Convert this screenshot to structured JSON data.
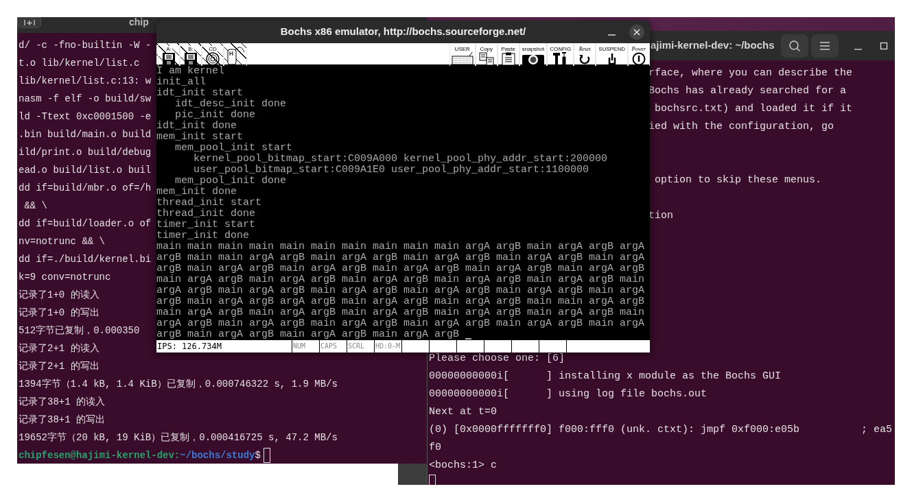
{
  "terminal_left": {
    "title": "chip",
    "lines": [
      "d/ -c -fno-builtin -W -",
      "t.o lib/kernel/list.c",
      "lib/kernel/list.c:13: w",
      "nasm -f elf -o build/sw",
      "ld -Ttext 0xc0001500 -e",
      ".bin build/main.o build",
      "ild/print.o build/debug",
      "ead.o build/list.o buil",
      "dd if=build/mbr.o of=/h",
      " && \\",
      "dd if=build/loader.o of",
      "nv=notrunc && \\",
      "dd if=./build/kernel.bi",
      "k=9 conv=notrunc",
      "记录了1+0 的读入",
      "记录了1+0 的写出",
      "512字节已复制，0.000350",
      "记录了2+1 的读入",
      "记录了2+1 的写出",
      "1394字节（1.4 kB, 1.4 KiB）已复制，0.000746322 s, 1.9 MB/s",
      "记录了38+1 的读入",
      "记录了38+1 的写出",
      "19652字节（20 kB, 19 KiB）已复制，0.000416725 s, 47.2 MB/s"
    ],
    "prompt": {
      "user_host": "chipfesen@hajimi-kernel-dev:",
      "path": "~/bochs/study",
      "symbol": "$"
    }
  },
  "bochs": {
    "title": "Bochs x86 emulator, http://bochs.sourceforge.net/",
    "toolbar_left": [
      {
        "label": "A:",
        "kind": "floppy"
      },
      {
        "label": "B:",
        "kind": "floppy"
      },
      {
        "label": "CD",
        "kind": "cdrom"
      },
      {
        "kind": "mouse"
      }
    ],
    "toolbar_right": [
      {
        "label": "USER",
        "kind": "keyboard"
      },
      {
        "label": "Copy",
        "kind": "copy"
      },
      {
        "label": "Paste",
        "kind": "paste"
      },
      {
        "label": "snapshot",
        "kind": "camera"
      },
      {
        "label": "CONFIG",
        "kind": "config"
      },
      {
        "label": "Reset",
        "kind": "reset"
      },
      {
        "label": "SUSPEND",
        "kind": "suspend"
      },
      {
        "label": "Power",
        "kind": "power"
      }
    ],
    "screen_lines": [
      "I am kernel",
      "init_all",
      "idt_init start",
      "   idt_desc_init done",
      "   pic_init done",
      "idt_init done",
      "mem_init start",
      "   mem_pool_init start",
      "      kernel_pool_bitmap_start:C009A000 kernel_pool_phy_addr_start:200000",
      "      user_pool_bitmap_start:C009A1E0 user_pool_phy_addr_start:1100000",
      "   mem_pool_init done",
      "mem_init done",
      "thread_init start",
      "thread_init done",
      "timer_init start",
      "timer_init done",
      "main main main main main main main main main main argA argB main argA argB argA",
      "argB main main argA argB main argA argB main argA argB main argA argB main argA",
      "argB main argA argB main argA argB main argA argB main argA argB main argA argB",
      "main argA argB main argA argB main argA argB main argA argB main argA argB main",
      "argA argB main argA argB main argA argB main argA argB main argA argB main argA",
      "argB main argA argB argA argB main argA argB main argA argB main main argA argB",
      "main argA argB main argA argB main argA argB main argA argB main argA argB main",
      "argA argB main argA argB main argA argB main argA argB main argA argB main argA",
      "argB main argA argB main argA argB main argA argB"
    ],
    "status": [
      {
        "text": "IPS: 126.734M",
        "kind": "ips"
      },
      {
        "text": "NUM",
        "kind": "indicator",
        "active": false
      },
      {
        "text": "CAPS",
        "kind": "indicator",
        "active": false
      },
      {
        "text": "SCRL",
        "kind": "indicator",
        "active": false
      },
      {
        "text": "HD:0-M",
        "kind": "indicator",
        "active": false
      }
    ]
  },
  "terminal_right": {
    "title": "ajimi-kernel-dev: ~/bochs",
    "upper_lines": [
      "rface, where you can describe the",
      "Bochs has already searched for a",
      " bochsrc.txt) and loaded it if it",
      "ied with the configuration, go",
      " option to skip these menus.",
      "tion"
    ],
    "lines": [
      "Please choose one: [6]",
      "00000000000i[      ] installing x module as the Bochs GUI",
      "00000000000i[      ] using log file bochs.out",
      "Next at t=0",
      "(0) [0x0000fffffff0] f000:fff0 (unk. ctxt): jmpf 0xf000:e05b          ; ea5",
      "f0",
      "<bochs:1> c"
    ]
  }
}
